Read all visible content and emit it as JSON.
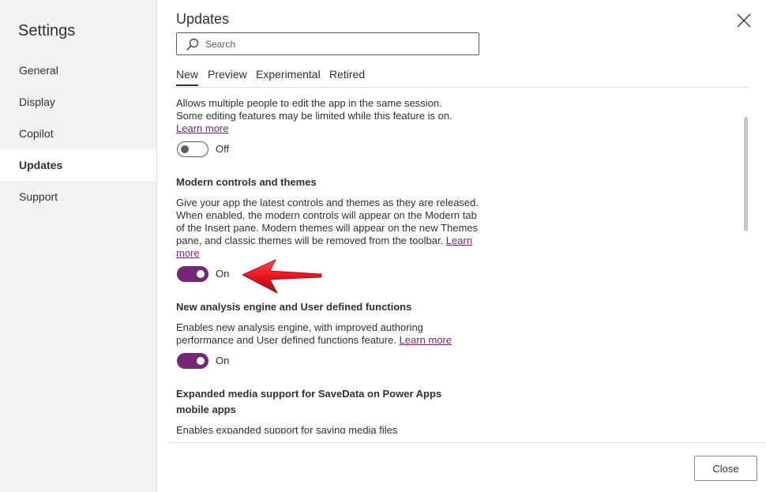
{
  "sidebar": {
    "title": "Settings",
    "items": [
      {
        "label": "General"
      },
      {
        "label": "Display"
      },
      {
        "label": "Copilot"
      },
      {
        "label": "Updates"
      },
      {
        "label": "Support"
      }
    ],
    "selected": "Updates"
  },
  "panel": {
    "title": "Updates",
    "search": {
      "placeholder": "Search",
      "value": ""
    },
    "tabs": [
      {
        "label": "New"
      },
      {
        "label": "Preview"
      },
      {
        "label": "Experimental"
      },
      {
        "label": "Retired"
      }
    ],
    "active_tab": "New"
  },
  "features": [
    {
      "title": "",
      "description_lines": [
        "Allows multiple people to edit the app in the same session.",
        "Some editing features may be limited while this feature is on."
      ],
      "learn_more": "Learn more",
      "state": "Off"
    },
    {
      "title": "Modern controls and themes",
      "description": "Give your app the latest controls and themes as they are released. When enabled, the modern controls will appear on the Modern tab of the Insert pane. Modern themes will appear on the new Themes pane, and classic themes will be removed from the toolbar.",
      "learn_more": "Learn more",
      "state": "On"
    },
    {
      "title": "New analysis engine and User defined functions",
      "description": "Enables new analysis engine, with improved authoring performance and User defined functions feature.",
      "learn_more": "Learn more",
      "state": "On"
    },
    {
      "title": "Expanded media support for SaveData on Power Apps mobile apps",
      "description": "Enables expanded support for saving media files"
    }
  ],
  "footer": {
    "close_label": "Close"
  },
  "colors": {
    "accent": "#742774",
    "sidebar_bg": "#f3f2f1",
    "annotation_arrow": "#e8141b"
  },
  "icons": {
    "search": "search-icon",
    "close": "close-icon"
  }
}
